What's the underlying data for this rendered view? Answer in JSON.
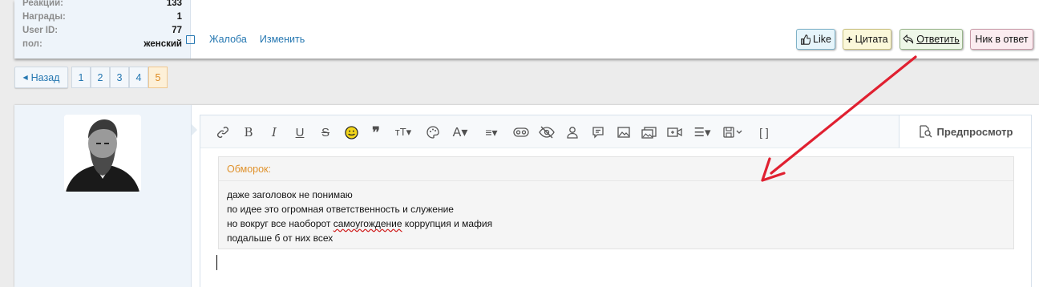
{
  "user_extras": [
    {
      "label": "Реакции:",
      "value": "133"
    },
    {
      "label": "Награды:",
      "value": "1"
    },
    {
      "label": "User ID:",
      "value": "77"
    },
    {
      "label": "пол:",
      "value": "женский"
    }
  ],
  "post_footer": {
    "report": "Жалоба",
    "edit": "Изменить"
  },
  "post_actions": {
    "like": "Like",
    "quote": "Цитата",
    "reply": "Ответить",
    "nick": "Ник в ответ"
  },
  "pagination": {
    "prev": "Назад",
    "pages": [
      "1",
      "2",
      "3",
      "4",
      "5"
    ],
    "current": "5"
  },
  "editor": {
    "preview": "Предпросмотр",
    "toolbar_icons": [
      "link-icon",
      "bold-icon",
      "italic-icon",
      "underline-icon",
      "strike-icon",
      "smilie-icon",
      "quote-icon",
      "font-size-icon",
      "color-icon",
      "font-family-icon",
      "align-icon",
      "spoiler-icon",
      "hide-icon",
      "user-icon",
      "inline-spoiler-icon",
      "image-icon",
      "media-icon",
      "video-icon",
      "list-icon",
      "drafts-icon",
      "bbcode-icon"
    ],
    "quote": {
      "author": "Обморок:",
      "lines": [
        "даже заголовок не понимаю",
        "по идее это огромная ответственность и служение",
        "но вокруг все наоборот самоугождение коррупция и мафия",
        "подальше б от них всех"
      ]
    }
  },
  "colors": {
    "link": "#2577b1",
    "quote_author": "#e0922c",
    "annotation_arrow": "#e02030"
  }
}
